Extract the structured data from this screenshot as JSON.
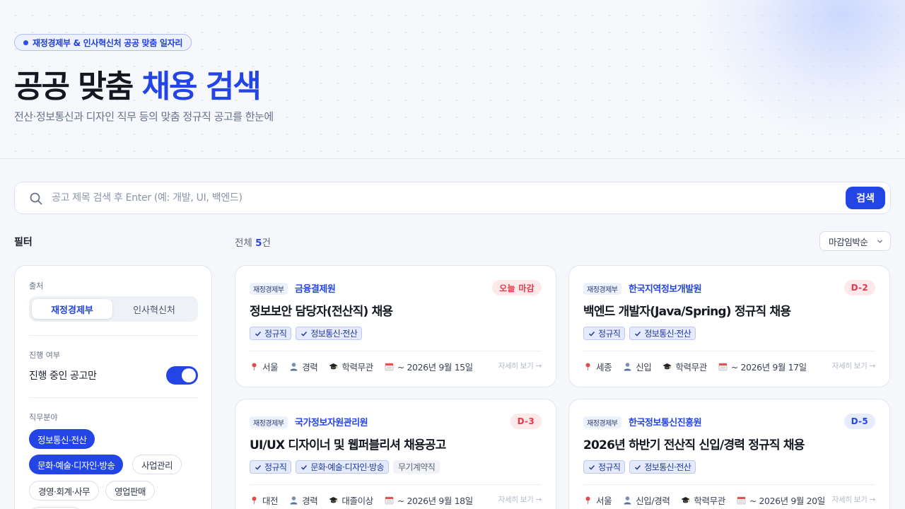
{
  "hero": {
    "badge": "재정경제부 & 인사혁신처 공공 맞춤 일자리",
    "title_main": "공공 맞춤 ",
    "title_accent": "채용 검색",
    "subtitle": "전산·정보통신과 디자인 직무 등의 맞춤 정규직 공고를 한눈에"
  },
  "search": {
    "placeholder": "공고 제목 검색 후 Enter (예: 개발, UI, 백엔드)",
    "value": "",
    "button_label": "검색",
    "icon": "search-icon"
  },
  "filter": {
    "title": "필터",
    "source_label": "출처",
    "source_options": [
      "재정경제부",
      "인사혁신처"
    ],
    "source_selected": "재정경제부",
    "progress_label": "진행 여부",
    "toggle_label": "진행 중인 공고만",
    "toggle_on": true,
    "field_label": "직무분야",
    "fields": [
      {
        "label": "정보통신·전산",
        "selected": true
      },
      {
        "label": "문화·예술·디자인·방송",
        "selected": true
      },
      {
        "label": "사업관리",
        "selected": false
      },
      {
        "label": "경영·회계·사무",
        "selected": false
      },
      {
        "label": "영업판매",
        "selected": false
      }
    ]
  },
  "results": {
    "total_prefix": "전체 ",
    "total_count": "5",
    "total_suffix": "건",
    "sort_label": "마감임박순"
  },
  "colors": {
    "accent": "#2445e6",
    "danger": "#e23a4a"
  },
  "cards": [
    {
      "source": "재정경제부",
      "org": "금융결제원",
      "dday": "오늘 마감",
      "dday_style": "red",
      "title": "정보보안 담당자(전산직) 채용",
      "tags": [
        {
          "text": "정규직",
          "check": true
        },
        {
          "text": "정보통신·전산",
          "check": true
        }
      ],
      "location": "서울",
      "career": "경력",
      "education": "학력무관",
      "deadline": "~ 2026년 9월 15일",
      "detail": "자세히 보기 →"
    },
    {
      "source": "재정경제부",
      "org": "한국지역정보개발원",
      "dday": "D-2",
      "dday_style": "red",
      "title": "백엔드 개발자(Java/Spring) 정규직 채용",
      "tags": [
        {
          "text": "정규직",
          "check": true
        },
        {
          "text": "정보통신·전산",
          "check": true
        }
      ],
      "location": "세종",
      "career": "신입",
      "education": "학력무관",
      "deadline": "~ 2026년 9월 17일",
      "detail": "자세히 보기 →"
    },
    {
      "source": "재정경제부",
      "org": "국가정보자원관리원",
      "dday": "D-3",
      "dday_style": "red",
      "title": "UI/UX 디자이너 및 웹퍼블리셔 채용공고",
      "tags": [
        {
          "text": "정규직",
          "check": true
        },
        {
          "text": "문화·예술·디자인·방송",
          "check": true
        },
        {
          "text": "무기계약직",
          "check": false
        }
      ],
      "location": "대전",
      "career": "경력",
      "education": "대졸이상",
      "deadline": "~ 2026년 9월 18일",
      "detail": "자세히 보기 →"
    },
    {
      "source": "재정경제부",
      "org": "한국정보통신진흥원",
      "dday": "D-5",
      "dday_style": "blue",
      "title": "2026년 하반기 전산직 신입/경력 정규직 채용",
      "tags": [
        {
          "text": "정규직",
          "check": true
        },
        {
          "text": "정보통신·전산",
          "check": true
        }
      ],
      "location": "서울",
      "career": "신입/경력",
      "education": "학력무관",
      "deadline": "~ 2026년 9월 20일",
      "detail": "자세히 보기 →"
    }
  ]
}
